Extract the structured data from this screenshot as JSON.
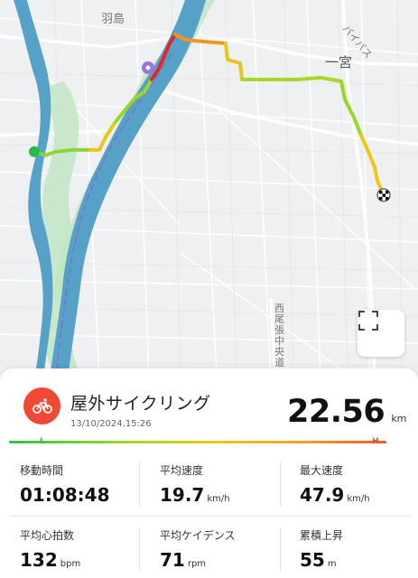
{
  "map": {
    "labels": {
      "hashima": "羽島",
      "ichinomiya": "一宮",
      "top_right_road": "バイパス",
      "bottom_road": "西尾張中央道"
    },
    "colors": {
      "water": "#55a1c8",
      "park": "#bfe6c1",
      "route_start": "#2bb94d"
    }
  },
  "fullscreen": {
    "icon": "fullscreen-icon"
  },
  "activity": {
    "icon": "bicycle-icon",
    "accent": "#f04a36",
    "title": "屋外サイクリング",
    "datetime": "13/10/2024,15:26",
    "distance": "22.56",
    "distance_unit": "km"
  },
  "gradient": {
    "low_label": "L",
    "high_label": "H"
  },
  "stats": {
    "moving_time": {
      "label": "移動時間",
      "value": "01:08:48",
      "unit": ""
    },
    "avg_speed": {
      "label": "平均速度",
      "value": "19.7",
      "unit": "km/h"
    },
    "max_speed": {
      "label": "最大速度",
      "value": "47.9",
      "unit": "km/h"
    },
    "avg_hr": {
      "label": "平均心拍数",
      "value": "132",
      "unit": "bpm"
    },
    "avg_cadence": {
      "label": "平均ケイデンス",
      "value": "71",
      "unit": "rpm"
    },
    "elevation_gain": {
      "label": "累積上昇",
      "value": "55",
      "unit": "m"
    }
  }
}
